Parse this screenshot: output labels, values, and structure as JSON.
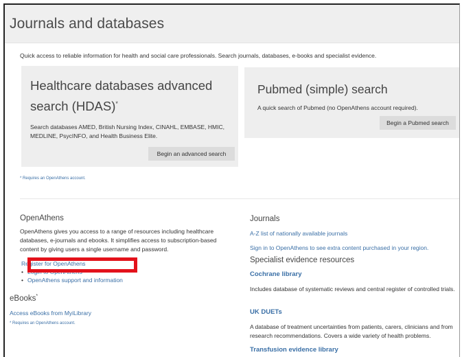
{
  "header": {
    "title": "Journals and databases"
  },
  "intro": "Quick access to reliable information for health and social care professionals. Search journals, databases, e-books and specialist evidence.",
  "hdas": {
    "title": "Healthcare databases advanced search (HDAS)",
    "title_mark": "*",
    "description": "Search databases AMED, British Nursing Index, CINAHL, EMBASE, HMIC, MEDLINE, PsycINFO, and Health Business Elite.",
    "button": "Begin an advanced search"
  },
  "pubmed": {
    "title": "Pubmed (simple) search",
    "description": "A quick search of Pubmed (no OpenAthens account required).",
    "button": "Begin a Pubmed search"
  },
  "footnote_top": "* Requires an OpenAthens account.",
  "openathens": {
    "title": "OpenAthens",
    "description": "OpenAthens gives you access to a range of resources including healthcare databases, e-journals and ebooks. It simplifies access to subscription-based content by giving users a single username and password.",
    "links": [
      "Register for OpenAthens",
      "Login to OpenAthens",
      "OpenAthens support and information"
    ]
  },
  "ebooks": {
    "title": "eBooks",
    "title_mark": "*",
    "link": "Access eBooks from MyiLibrary",
    "footnote": "* Requires an OpenAthens account."
  },
  "journals": {
    "title": "Journals",
    "links": [
      "A-Z list of nationally available journals",
      "Sign in to OpenAthens to see extra content purchased in your region."
    ]
  },
  "specialist": {
    "title": "Specialist evidence resources",
    "items": [
      {
        "name": "Cochrane library",
        "description": "Includes database of systematic reviews and central register of controlled trials."
      },
      {
        "name": "UK DUETs",
        "description": "A database of treatment uncertainties from patients, carers, clinicians and from research recommendations. Covers a wide variety of health problems."
      },
      {
        "name": "Transfusion evidence library",
        "description": ""
      }
    ]
  },
  "colors": {
    "link": "#3a6fa6",
    "highlight": "#e3121b",
    "panel": "#eeeeee"
  }
}
